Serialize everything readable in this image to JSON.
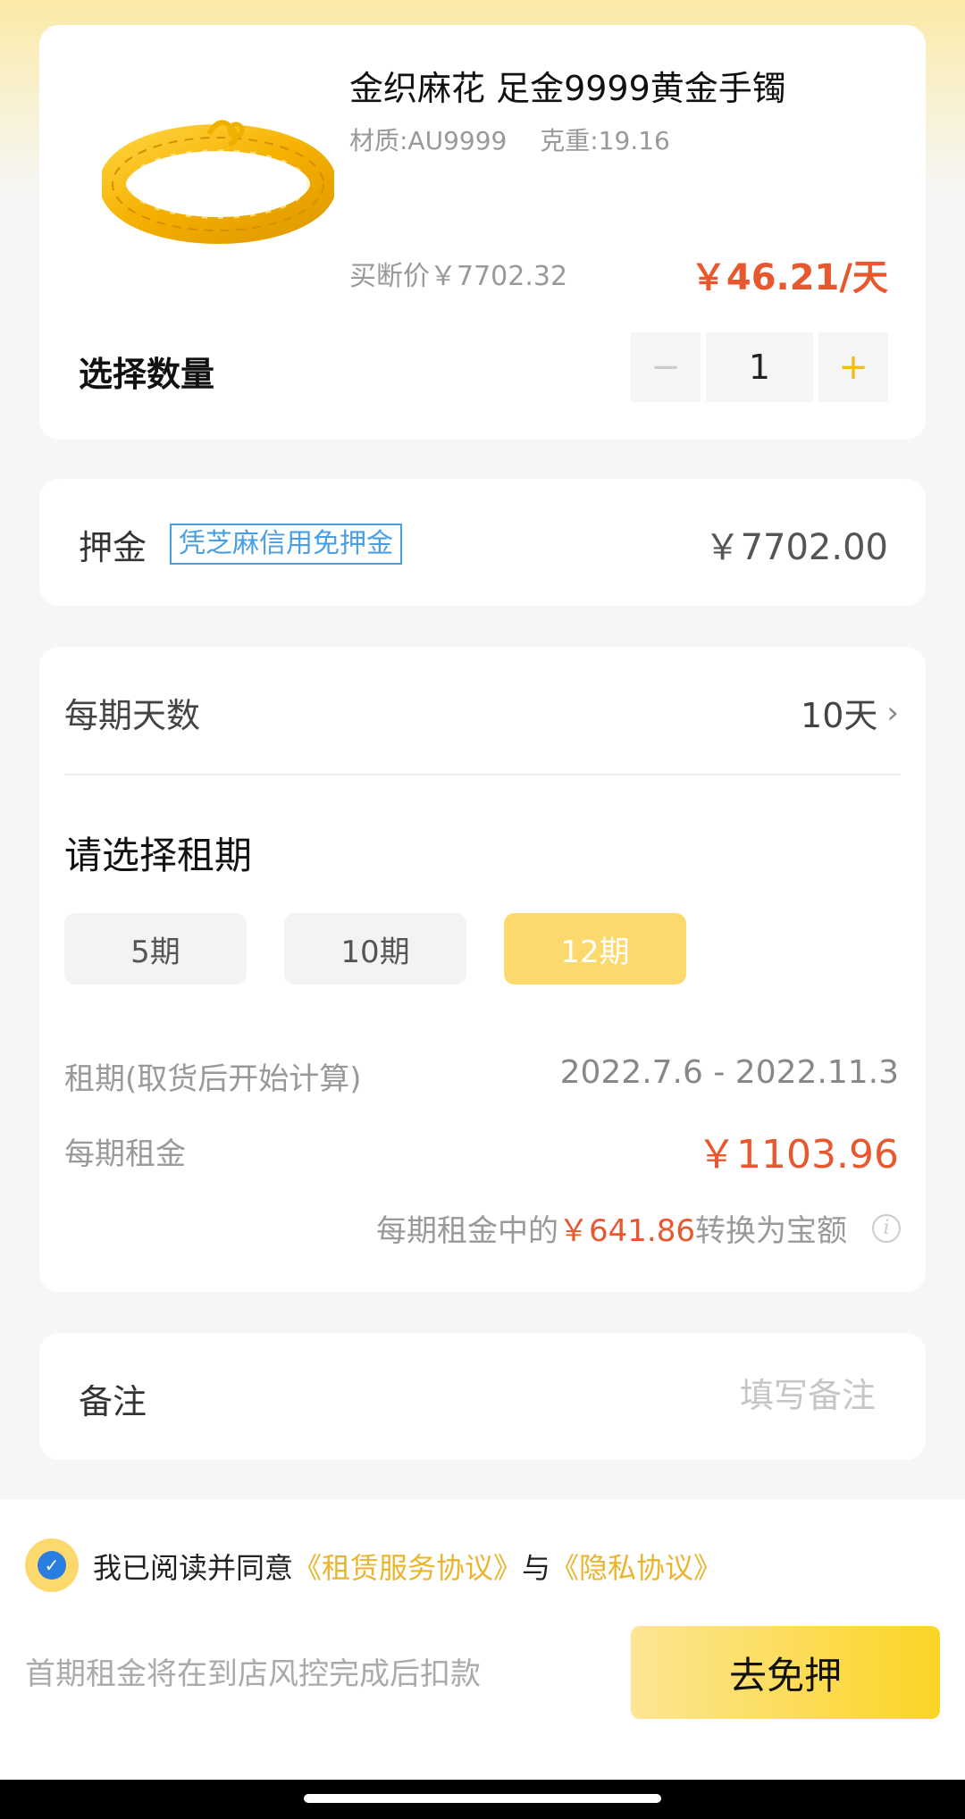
{
  "product": {
    "title": "金织麻花 足金9999黄金手镯",
    "material": "材质:AU9999",
    "weight": "克重:19.16",
    "buyout_price": "买断价￥7702.32",
    "daily_price": "￥46.21/天",
    "qty_label": "选择数量",
    "qty_minus": "−",
    "qty_value": "1",
    "qty_plus": "+"
  },
  "deposit": {
    "label": "押金",
    "tag": "凭芝麻信用免押金",
    "amount": "￥7702.00"
  },
  "term": {
    "days_label": "每期天数",
    "days_value": "10天",
    "chevron": "›",
    "title": "请选择租期",
    "options": [
      "5期",
      "10期",
      "12期"
    ],
    "selected_index": 2,
    "period_label": "租期(取货后开始计算)",
    "period_value": "2022.7.6 - 2022.11.3",
    "rent_label": "每期租金",
    "rent_value": "￥1103.96",
    "convert_prefix": "每期租金中的",
    "convert_amount": "￥641.86",
    "convert_suffix": "转换为宝额",
    "info_glyph": "i"
  },
  "remark": {
    "label": "备注",
    "placeholder": "填写备注"
  },
  "footer": {
    "agree_prefix": "我已阅读并同意",
    "agree_link1": "《租赁服务协议》",
    "agree_mid": "与",
    "agree_link2": "《隐私协议》",
    "check_glyph": "✓",
    "notice": "首期租金将在到店风控完成后扣款",
    "submit_label": "去免押"
  },
  "colors": {
    "accent_yellow": "#fcd96d",
    "price_red": "#e8582f",
    "link_gold": "#e9b42e",
    "tag_blue": "#4a9fe3"
  }
}
